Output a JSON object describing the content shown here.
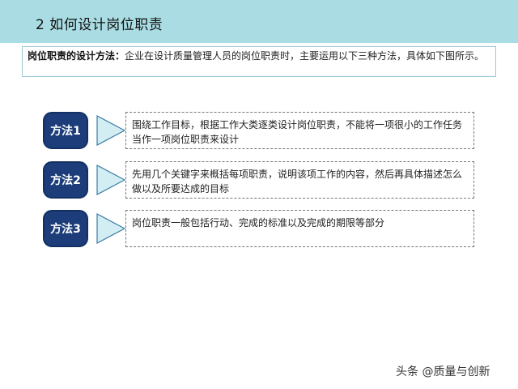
{
  "header": {
    "title": "2   如何设计岗位职责"
  },
  "intro": {
    "label": "岗位职责的设计方法：",
    "text": "企业在设计质量管理人员的岗位职责时，主要运用以下三种方法，具体如下图所示。"
  },
  "methods": [
    {
      "label": "方法1",
      "desc": "围绕工作目标，根据工作大类逐类设计岗位职责，不能将一项很小的工作任务当作一项岗位职责来设计"
    },
    {
      "label": "方法2",
      "desc": "先用几个关键字来概括每项职责，说明该项工作的内容，然后再具体描述怎么做以及所要达成的目标"
    },
    {
      "label": "方法3",
      "desc": "岗位职责一般包括行动、完成的标准以及完成的期限等部分"
    }
  ],
  "watermark": "头条 @质量与创新",
  "colors": {
    "header_bg": "#a9dde3",
    "button_bg": "#1c3d7a",
    "arrow_fill": "#d3eef2",
    "arrow_stroke": "#3a7ca5"
  }
}
